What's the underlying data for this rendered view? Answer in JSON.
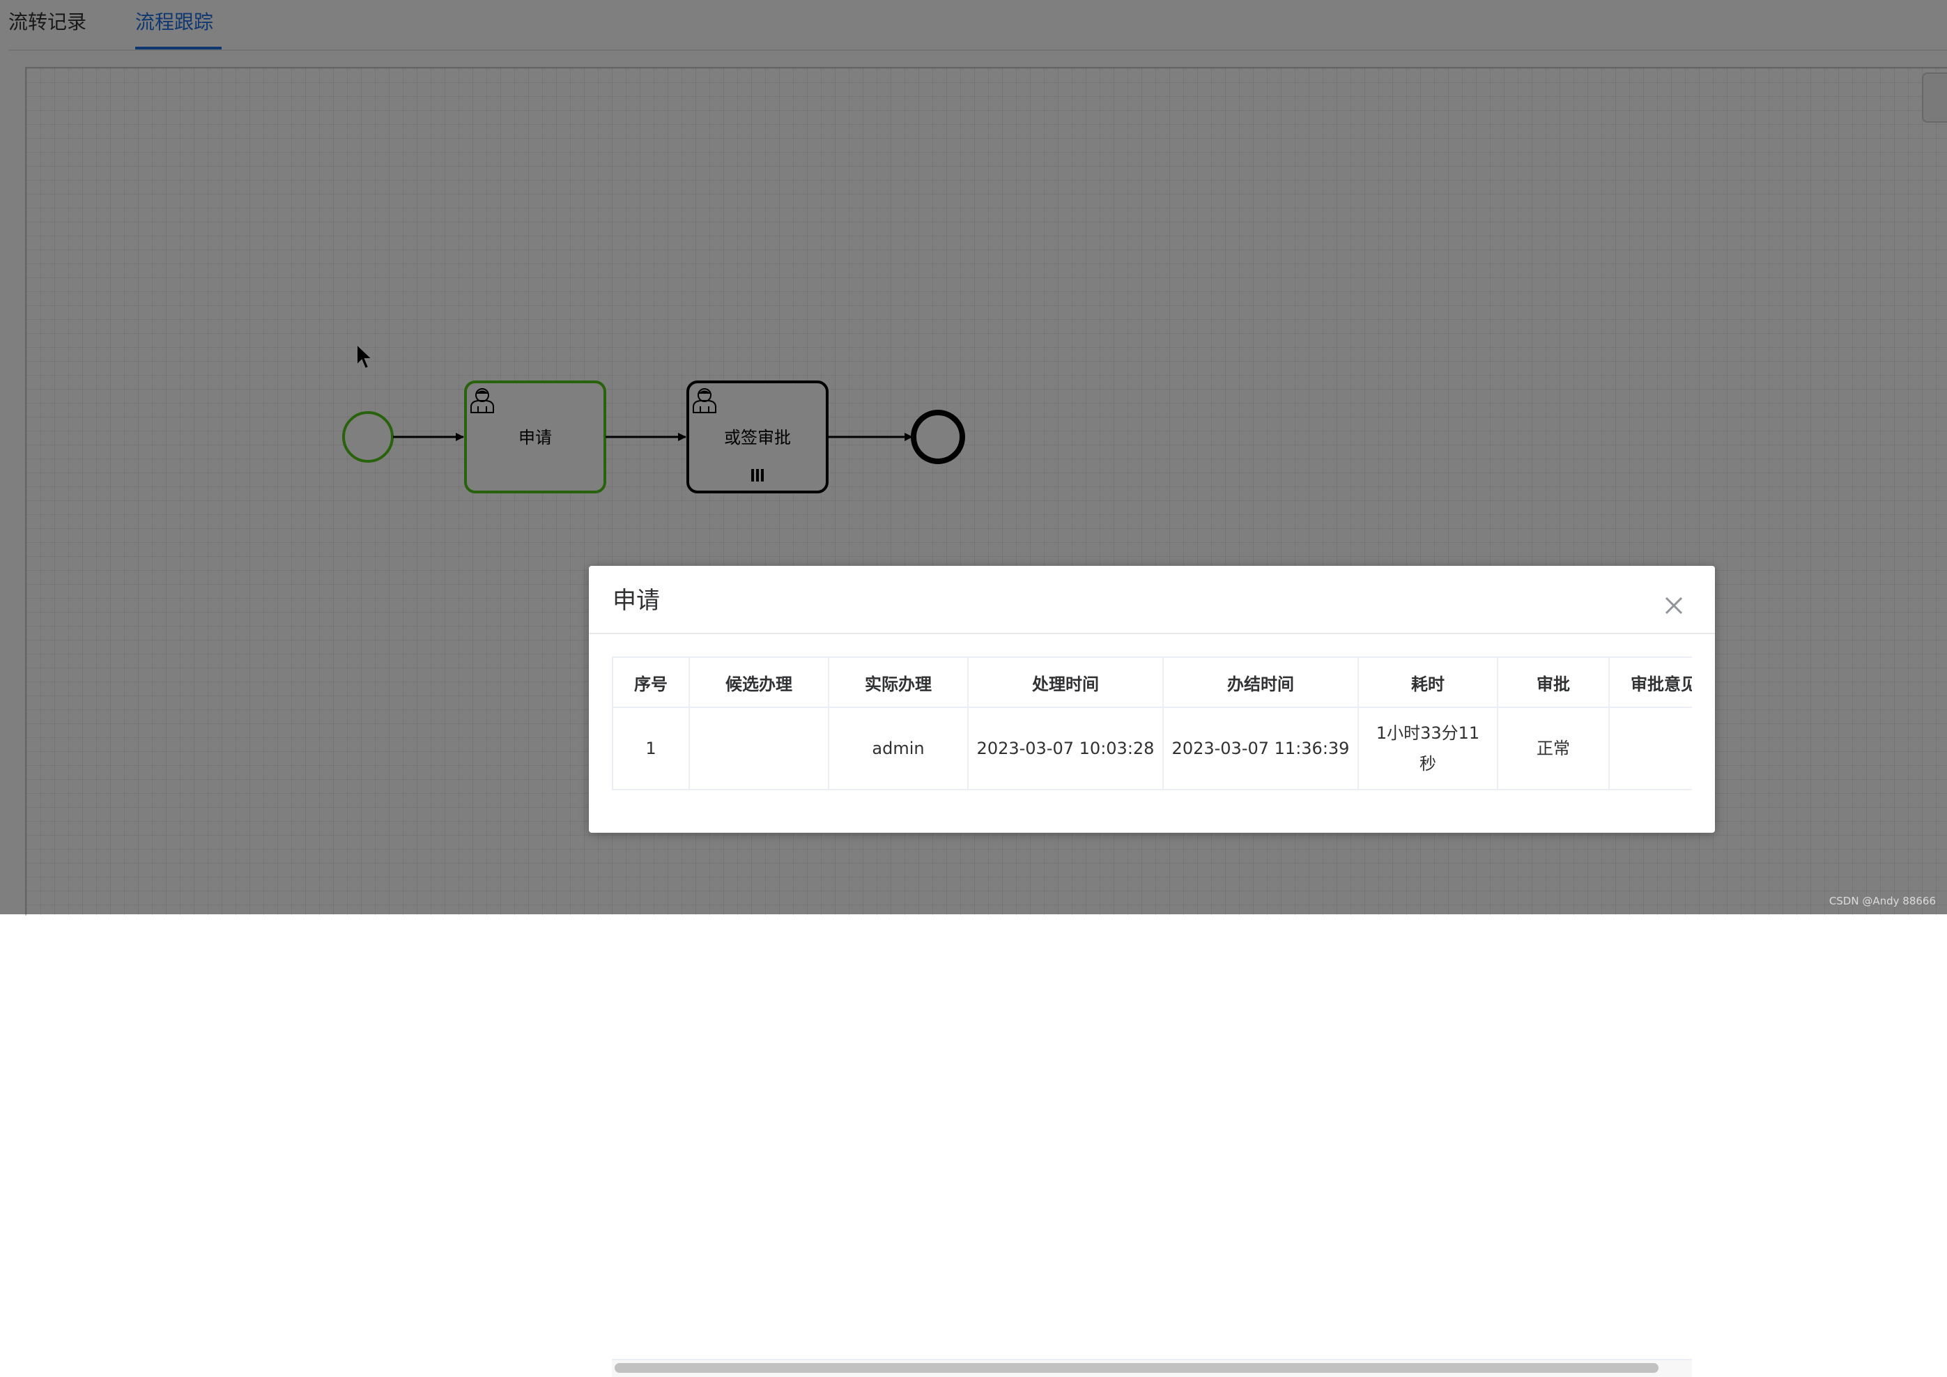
{
  "tabs": [
    {
      "label": "流转记录",
      "active": false
    },
    {
      "label": "流程跟踪",
      "active": true
    }
  ],
  "diagram": {
    "nodes": {
      "task_apply": "申请",
      "task_approve": "或签审批"
    },
    "start_event_color": "#52c41a",
    "active_task_color": "#52c41a"
  },
  "dialog": {
    "title": "申请",
    "table": {
      "columns": [
        "序号",
        "候选办理",
        "实际办理",
        "处理时间",
        "办结时间",
        "耗时",
        "审批",
        "审批意见"
      ],
      "rows": [
        [
          "1",
          "",
          "admin",
          "2023-03-07 10:03:28",
          "2023-03-07 11:36:39",
          "1小时33分11秒",
          "正常",
          ""
        ]
      ]
    }
  },
  "watermark": "CSDN @Andy 88666",
  "colors": {
    "accent": "#1f6fe0",
    "completed": "#52c41a"
  }
}
